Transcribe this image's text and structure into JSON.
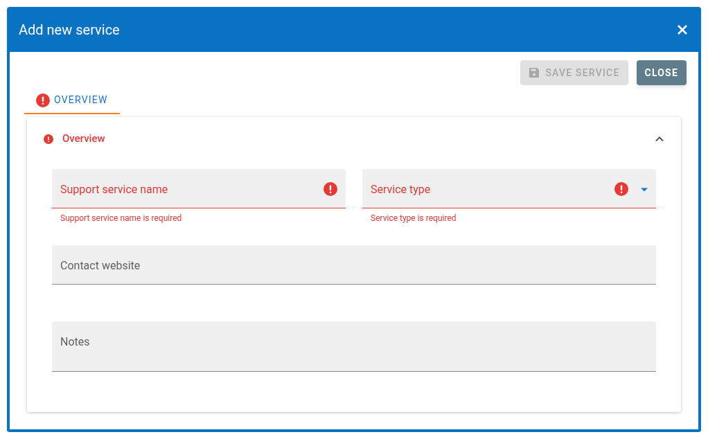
{
  "dialog": {
    "title": "Add new service"
  },
  "toolbar": {
    "buttons": [
      {
        "kind": "save",
        "label": "SAVE SERVICE",
        "disabled": true
      },
      {
        "kind": "close",
        "label": "CLOSE",
        "disabled": false
      }
    ]
  },
  "tabs": [
    {
      "label": "OVERVIEW",
      "selected": true,
      "error": true
    }
  ],
  "panel": {
    "title": "Overview",
    "error": true,
    "expanded": true,
    "rows": [
      {
        "fields": [
          {
            "kind": "text",
            "label": "Support service name",
            "error": true,
            "error_message": "Support service name is required"
          },
          {
            "kind": "select",
            "label": "Service type",
            "error": true,
            "error_message": "Service type is required"
          }
        ]
      },
      {
        "fields": [
          {
            "kind": "text",
            "label": "Contact website",
            "error": false
          }
        ]
      },
      {
        "fields": [
          {
            "kind": "textarea",
            "label": "Notes",
            "error": false
          }
        ]
      }
    ]
  }
}
